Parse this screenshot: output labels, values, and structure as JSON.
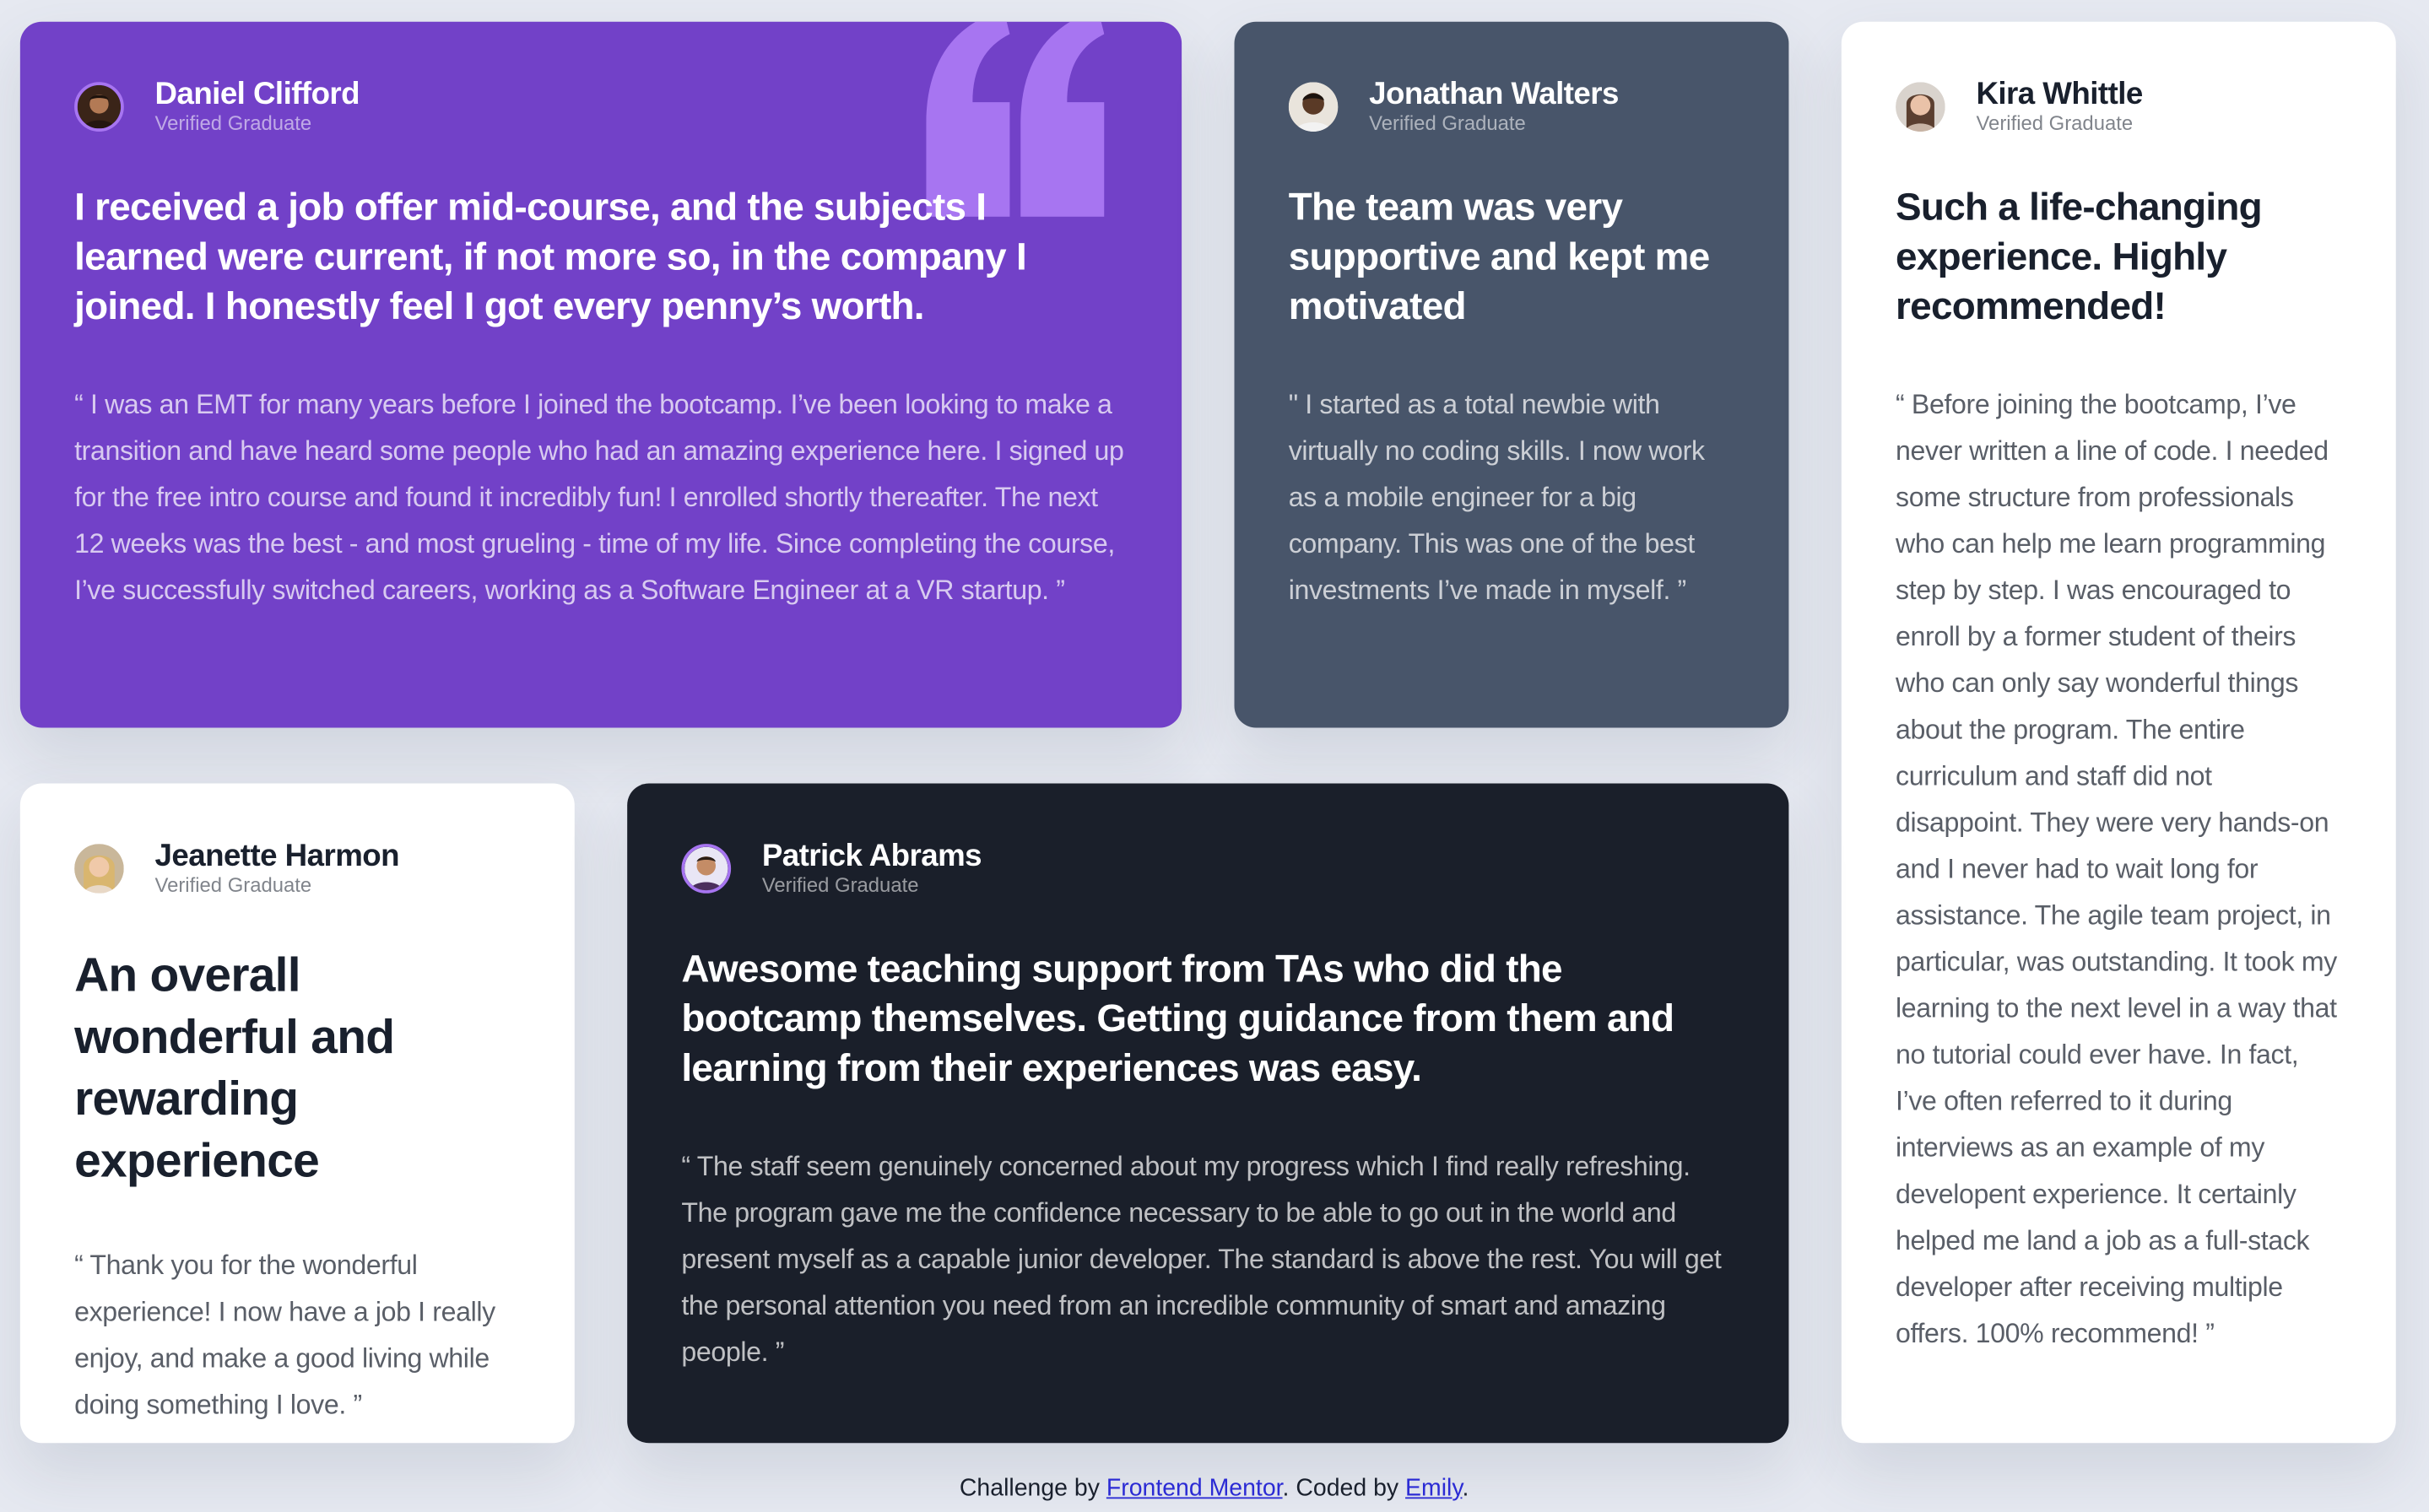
{
  "colors": {
    "background": "#e6e9f1",
    "moderate_violet": "#7241c8",
    "grayish_blue": "#48556a",
    "dark_blackish_blue": "#1a1f2a",
    "white": "#ffffff",
    "quote_mark": "#a775f1"
  },
  "testimonials": [
    {
      "id": "daniel",
      "name": "Daniel Clifford",
      "role": "Verified Graduate",
      "avatar_icon": "avatar-daniel-icon",
      "headline": "I received a job offer mid-course, and the subjects I learned were current, if not more so, in the company I joined. I honestly feel I got every penny’s worth.",
      "body": "“ I was an EMT for many years before I joined the bootcamp. I’ve been looking to make a transition and have heard some people who had an amazing experience here. I signed up for the free intro course and found it incredibly fun! I enrolled shortly thereafter. The next 12 weeks was the best - and most grueling - time of my life. Since completing the course, I’ve successfully switched careers, working as a Software Engineer at a VR startup. ”"
    },
    {
      "id": "jonathan",
      "name": "Jonathan Walters",
      "role": "Verified Graduate",
      "avatar_icon": "avatar-jonathan-icon",
      "headline": "The team was very supportive and kept me motivated",
      "body": "\" I started as a total newbie with virtually no coding skills. I now work as a mobile engineer for a big company. This was one of the best investments I’ve made in myself. ”"
    },
    {
      "id": "kira",
      "name": "Kira Whittle",
      "role": "Verified Graduate",
      "avatar_icon": "avatar-kira-icon",
      "headline": "Such a life-changing experience. Highly recommended!",
      "body": "“ Before joining the bootcamp, I’ve never written a line of code. I needed some structure from professionals who can help me learn programming step by step. I was encouraged to enroll by a former student of theirs who can only say wonderful things about the program. The entire curriculum and staff did not disappoint. They were very hands-on and I never had to wait long for assistance. The agile team project, in particular, was outstanding. It took my learning to the next level in a way that no tutorial could ever have. In fact, I’ve often referred to it during interviews as an example of my developent experience. It certainly helped me land a job as a full-stack developer after receiving multiple offers. 100% recommend! ”"
    },
    {
      "id": "jeanette",
      "name": "Jeanette Harmon",
      "role": "Verified Graduate",
      "avatar_icon": "avatar-jeanette-icon",
      "headline": "An overall wonderful and rewarding experience",
      "body": "“ Thank you for the wonderful experience! I now have a job I really enjoy, and make a good living while doing something I love. ”"
    },
    {
      "id": "patrick",
      "name": "Patrick Abrams",
      "role": "Verified Graduate",
      "avatar_icon": "avatar-patrick-icon",
      "headline": "Awesome teaching support from TAs who did the bootcamp themselves. Getting guidance from them and learning from their experiences was easy.",
      "body": "“ The staff seem genuinely concerned about my progress which I find really refreshing. The program gave me the confidence necessary to be able to go out in the world and present myself as a capable junior developer. The standard is above the rest. You will get the personal attention you need from an incredible community of smart and amazing people. ”"
    }
  ],
  "decorations": {
    "quote_icon": "quotation-mark-icon"
  },
  "footer": {
    "prefix": "Challenge by",
    "challenge_link": "Frontend Mentor",
    "middle": ". Coded by",
    "author_link": "Emily",
    "suffix": "."
  }
}
